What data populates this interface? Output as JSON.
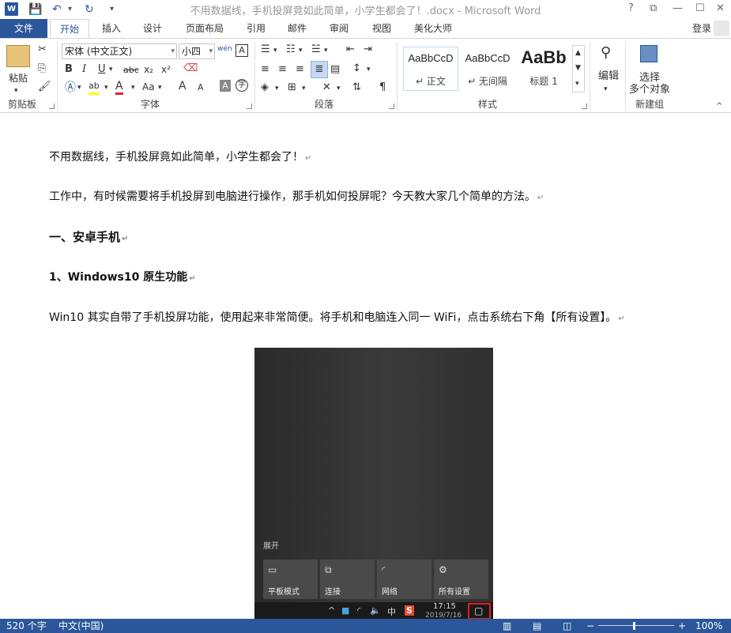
{
  "titlebar": {
    "app_icon": "W",
    "title": "不用数据线，手机投屏竟如此简单，小学生都会了！.docx - Microsoft Word",
    "qat_icons": [
      "save-icon",
      "undo-icon",
      "redo-icon",
      "customize-icon"
    ],
    "help": "?",
    "ribbon_display": "⧉",
    "minimize": "—",
    "maximize": "☐",
    "close": "✕"
  },
  "tabs": {
    "file": "文件",
    "items": [
      "开始",
      "插入",
      "设计",
      "页面布局",
      "引用",
      "邮件",
      "审阅",
      "视图",
      "美化大师"
    ],
    "active": "开始",
    "login": "登录"
  },
  "ribbon": {
    "clipboard": {
      "label": "剪贴板",
      "paste": "粘贴"
    },
    "font": {
      "label": "字体",
      "font_name": "宋体 (中文正文)",
      "font_size": "小四",
      "bold": "B",
      "italic": "I",
      "underline": "U",
      "strike": "abc",
      "subscript": "x₂",
      "superscript": "x²",
      "phonetic": "wén",
      "grow": "A",
      "shrink": "A",
      "case": "Aa"
    },
    "paragraph": {
      "label": "段落"
    },
    "styles": {
      "label": "样式",
      "items": [
        {
          "sample": "AaBbCcD",
          "name": "↵ 正文"
        },
        {
          "sample": "AaBbCcD",
          "name": "↵ 无间隔"
        },
        {
          "sample": "AaBb",
          "name": "标题 1"
        }
      ]
    },
    "editing": {
      "label": "编辑"
    },
    "newgroup": {
      "label": "新建组",
      "select": "选择",
      "select2": "多个对象"
    }
  },
  "document": {
    "paragraphs": [
      "不用数据线，手机投屏竟如此简单，小学生都会了！",
      "工作中，有时候需要将手机投屏到电脑进行操作，那手机如何投屏呢？今天教大家几个简单的方法。",
      "一、安卓手机",
      "1、Windows10 原生功能",
      "Win10 其实自带了手机投屏功能，使用起来非常简便。将手机和电脑连入同一 WiFi，点击系统右下角【所有设置】。"
    ],
    "para_mark": "↵",
    "screenshot": {
      "expand": "展开",
      "tiles": [
        "平板模式",
        "连接",
        "网络",
        "所有设置"
      ],
      "ime": "中",
      "sogou": "S",
      "time": "17:15",
      "date": "2019/7/16"
    }
  },
  "statusbar": {
    "word_count": "520 个字",
    "language": "中文(中国)",
    "zoom": "100%",
    "zoom_minus": "−",
    "zoom_plus": "+",
    "zoom_level": 1.0
  },
  "colors": {
    "accent": "#2b579a",
    "highlight_yellow": "#ffff00",
    "font_red": "#e02020"
  }
}
